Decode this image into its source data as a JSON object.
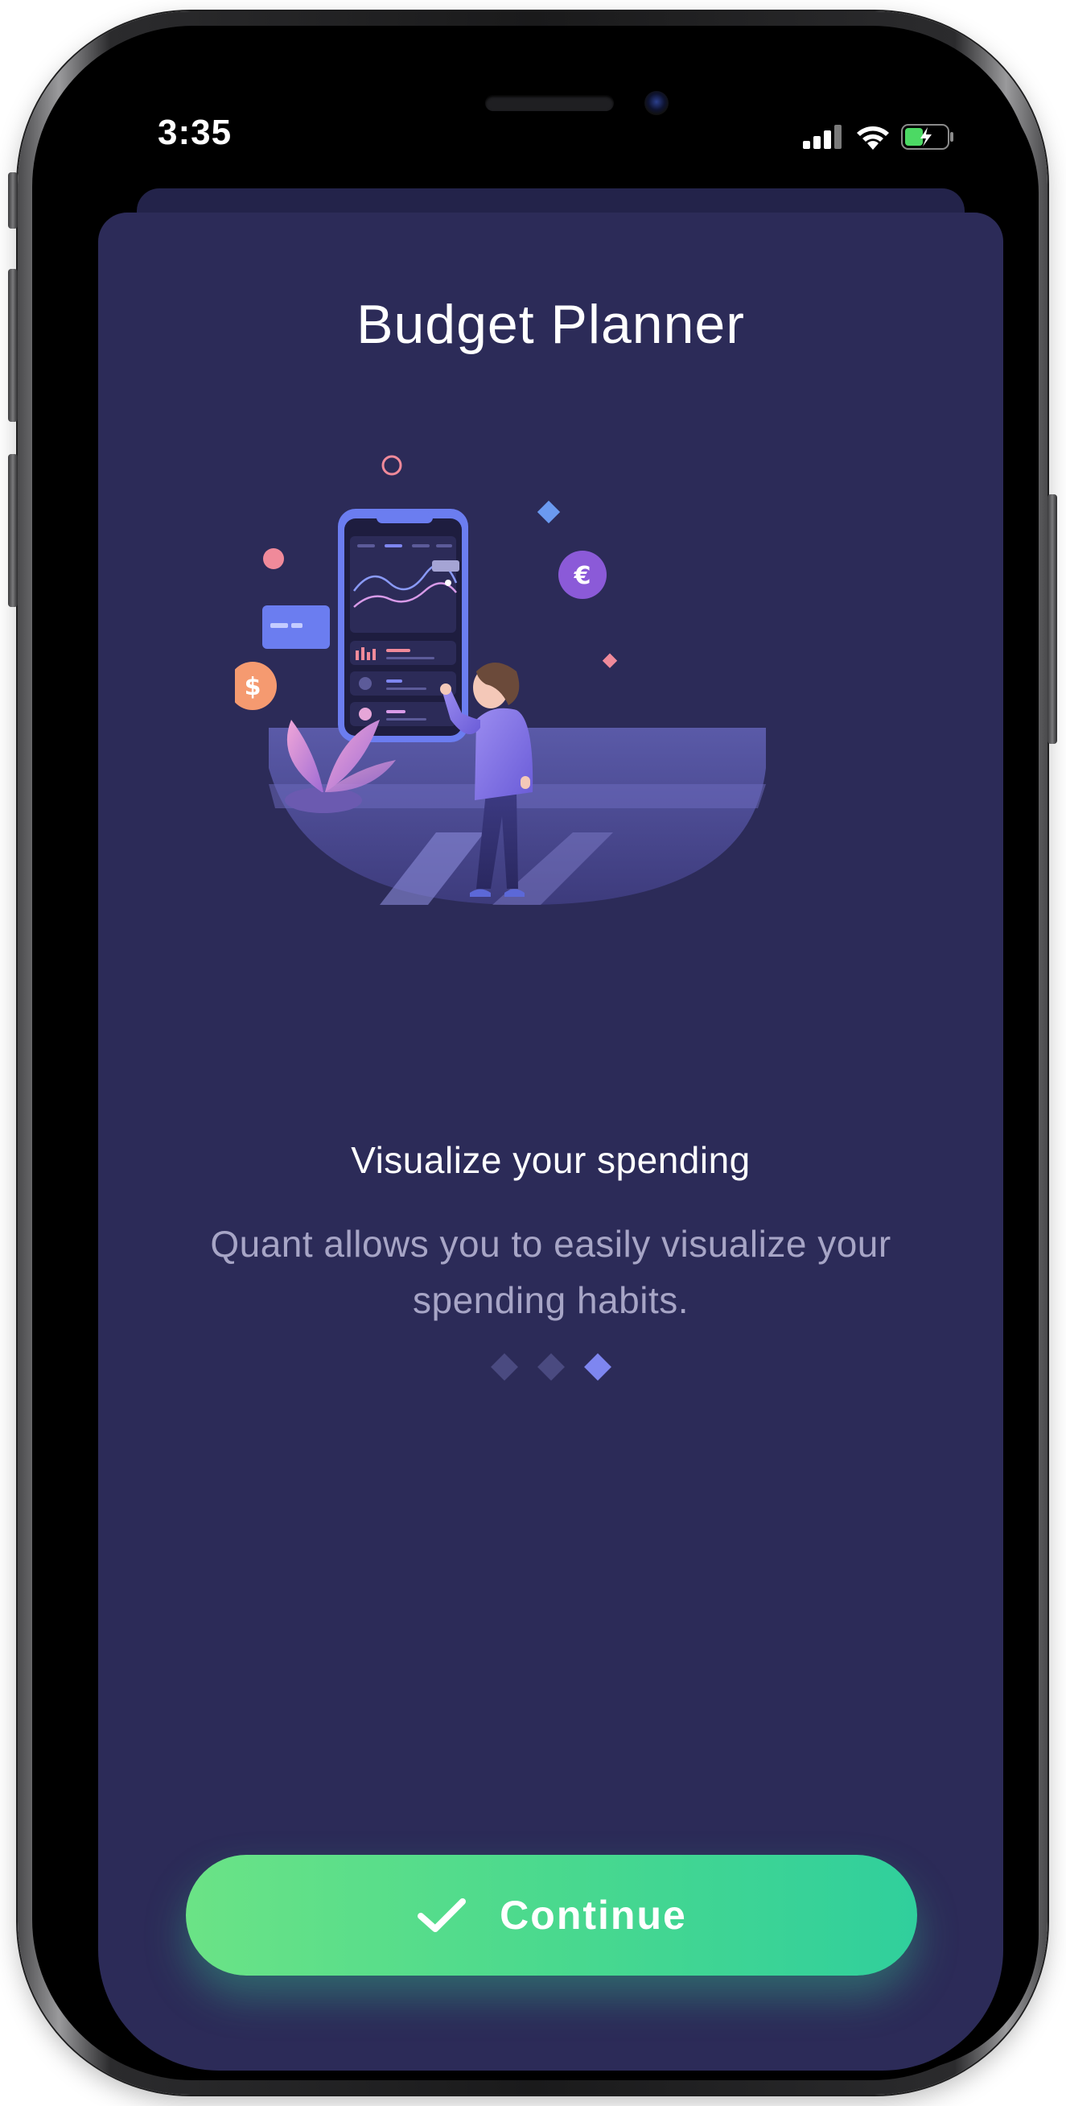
{
  "status_bar": {
    "time": "3:35",
    "icons": [
      "cellular-signal-icon",
      "wifi-icon",
      "battery-charging-icon"
    ]
  },
  "onboarding": {
    "title": "Budget Planner",
    "illustration": "person-viewing-phone-charts-illustration",
    "heading": "Visualize your spending",
    "description": "Quant allows you to easily visualize your spending habits.",
    "page_indicator": {
      "total": 3,
      "current": 3
    }
  },
  "continue_button": {
    "label": "Continue",
    "icon": "checkmark-icon"
  },
  "colors": {
    "background": "#2c2b58",
    "accent": "#7e86f0",
    "button_start": "#6be386",
    "button_end": "#30cf9c"
  }
}
